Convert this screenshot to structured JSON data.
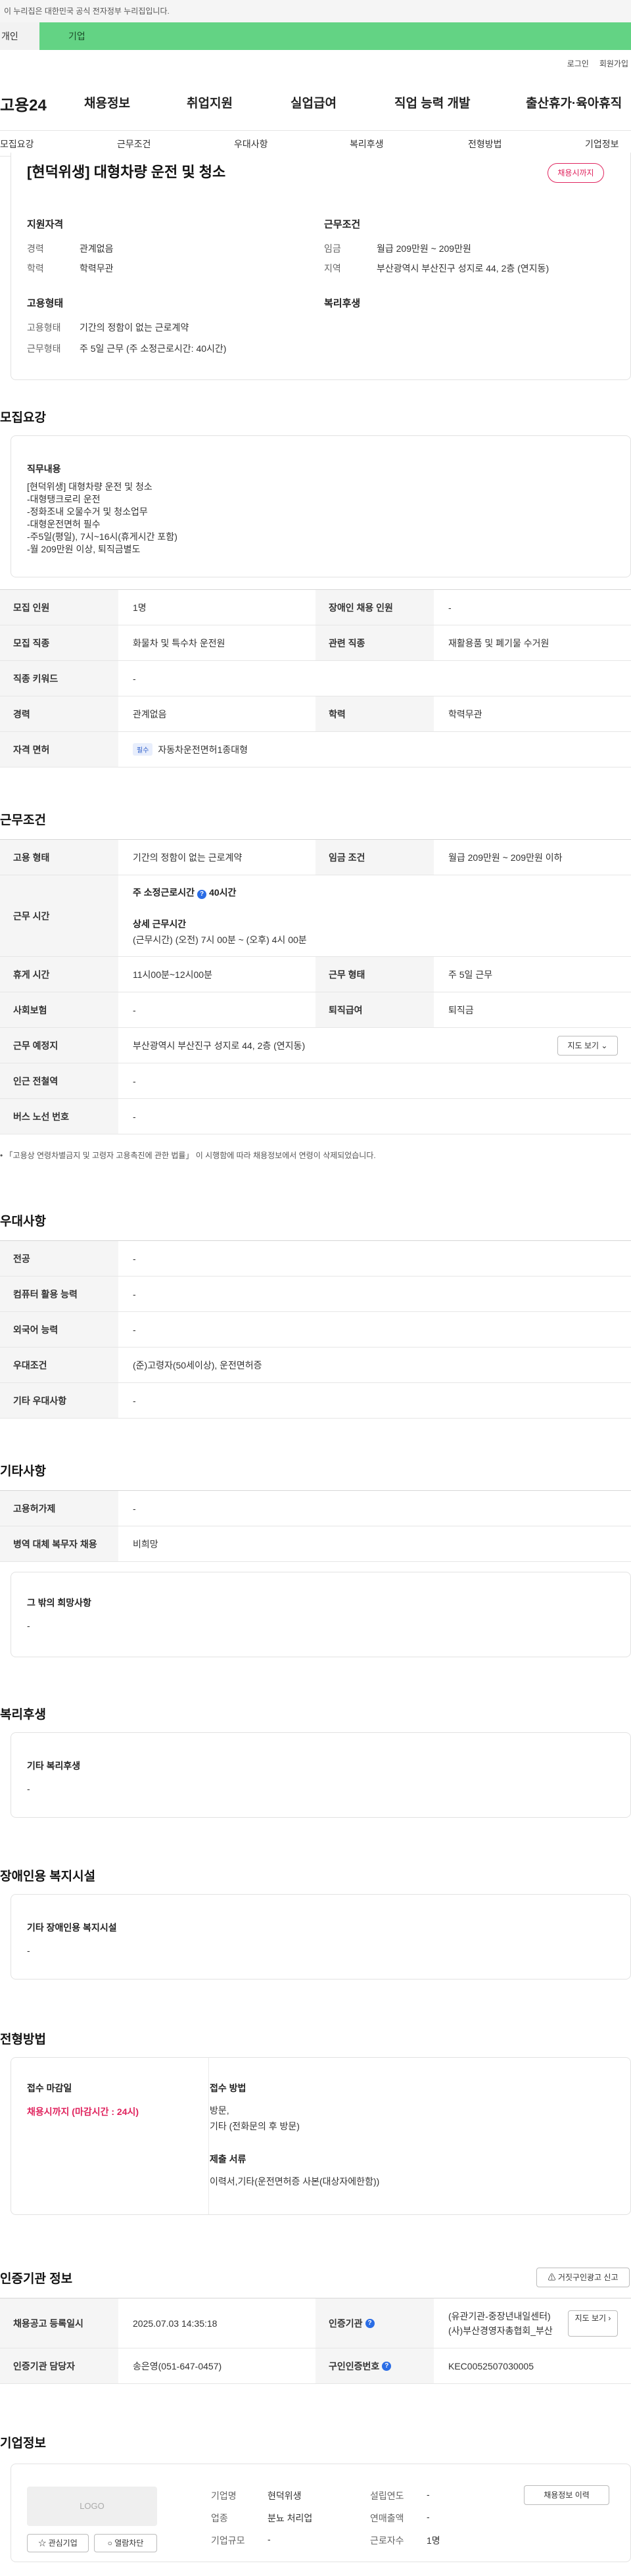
{
  "gov_banner": "이 누리집은 대한민국 공식 전자정부 누리집입니다.",
  "site_tabs": [
    "개인",
    "기업"
  ],
  "util_links": [
    "로그인",
    "회원가입"
  ],
  "logo": "고용24",
  "gnb": [
    "채용정보",
    "취업지원",
    "실업급여",
    "직업 능력 개발",
    "출산휴가·육아휴직"
  ],
  "subnav": [
    "모집요강",
    "근무조건",
    "우대사항",
    "복리후생",
    "전형방법",
    "기업정보"
  ],
  "job": {
    "title": "[현덕위생] 대형차량 운전 및 청소",
    "badge": "채용시까지",
    "qual_head": "지원자격",
    "qual": [
      {
        "k": "경력",
        "v": "관계없음"
      },
      {
        "k": "학력",
        "v": "학력무관"
      }
    ],
    "cond_head": "근무조건",
    "cond": [
      {
        "k": "임금",
        "v": "월급 209만원 ~ 209만원"
      },
      {
        "k": "지역",
        "v": "부산광역시 부산진구 성지로 44, 2층 (연지동)"
      }
    ],
    "emp_head": "고용형태",
    "emp": [
      {
        "k": "고용형태",
        "v": "기간의 정함이 없는 근로계약"
      },
      {
        "k": "근무형태",
        "v": "주 5일 근무 (주 소정근로시간: 40시간)"
      }
    ],
    "welfare_head": "복리후생"
  },
  "recruit": {
    "title": "모집요강",
    "duty_head": "직무내용",
    "duty_body": "[현덕위생] 대형차량 운전 및 청소\n-대형탱크로리 운전\n-정화조내 오물수거 및 청소업무\n-대형운전면허 필수\n-주5일(평일), 7시~16시(휴게시간 포함)\n-월 209만원 이상, 퇴직금별도",
    "rows": [
      {
        "k1": "모집 인원",
        "v1": "1명",
        "k2": "장애인 채용 인원",
        "v2": "-"
      },
      {
        "k1": "모집 직종",
        "v1": "화물차 및 특수차 운전원",
        "k2": "관련 직종",
        "v2": "재활용품 및 폐기물 수거원"
      },
      {
        "k1": "직종 키워드",
        "v1": "-"
      },
      {
        "k1": "경력",
        "v1": "관계없음",
        "k2": "학력",
        "v2": "학력무관"
      },
      {
        "k1": "자격 면허",
        "pill": "필수",
        "v1": "자동차운전면허1종대형"
      }
    ]
  },
  "workcond": {
    "title": "근무조건",
    "r1": {
      "k1": "고용 형태",
      "v1": "기간의 정함이 없는 근로계약",
      "k2": "임금 조건",
      "v2": "월급 209만원 ~ 209만원 이하"
    },
    "r2": {
      "k1": "근무 시간",
      "line1a": "주 소정근로시간",
      "line1b": "40시간",
      "line2": "상세 근무시간",
      "line3": "(근무시간) (오전) 7시 00분 ~ (오후) 4시 00분"
    },
    "r3": {
      "k1": "휴게 시간",
      "v1": "11시00분~12시00분",
      "k2": "근무 형태",
      "v2": "주 5일 근무"
    },
    "r4": {
      "k1": "사회보험",
      "v1": "-",
      "k2": "퇴직급여",
      "v2": "퇴직금"
    },
    "r5": {
      "k1": "근무 예정지",
      "v1": "부산광역시 부산진구 성지로 44, 2층 (연지동)",
      "btn": "지도 보기"
    },
    "r6": {
      "k1": "인근 전철역",
      "v1": "-"
    },
    "r7": {
      "k1": "버스 노선 번호",
      "v1": "-"
    },
    "note": "「고용상 연령차별금지 및 고령자 고용촉진에 관한 법률」 이 시행함에 따라 채용정보에서 연령이 삭제되었습니다."
  },
  "pref": {
    "title": "우대사항",
    "rows": [
      {
        "k": "전공",
        "v": "-"
      },
      {
        "k": "컴퓨터 활용 능력",
        "v": "-"
      },
      {
        "k": "외국어 능력",
        "v": "-"
      },
      {
        "k": "우대조건",
        "v": "(준)고령자(50세이상), 운전면허증"
      },
      {
        "k": "기타 우대사항",
        "v": "-"
      }
    ]
  },
  "etc": {
    "title": "기타사항",
    "rows": [
      {
        "k": "고용허가제",
        "v": "-"
      },
      {
        "k": "병역 대체 복무자 채용",
        "v": "비희망"
      }
    ],
    "card_head": "그 밖의 희망사항",
    "card_body": "-"
  },
  "welfare": {
    "title": "복리후생",
    "card_head": "기타 복리후생",
    "card_body": "-"
  },
  "disabled": {
    "title": "장애인용 복지시설",
    "card_head": "기타 장애인용 복지시설",
    "card_body": "-"
  },
  "screening": {
    "title": "전형방법",
    "deadline_head": "접수 마감일",
    "deadline": "채용시까지 (마감시간 : 24시)",
    "method_head": "접수 방법",
    "method": "방문,\n기타 (전화문의 후 방문)",
    "docs_head": "제출 서류",
    "docs": "이력서,기타(운전면허증 사본(대상자에한함))"
  },
  "cert": {
    "title": "인증기관 정보",
    "report_btn": "거짓구인광고 신고",
    "r1": {
      "k1": "채용공고 등록일시",
      "v1": "2025.07.03 14:35:18",
      "k2": "인증기관",
      "v2": "(유관기관-중장년내일센터) (사)부산경영자총협회_부산",
      "btn": "지도 보기"
    },
    "r2": {
      "k1": "인증기관 담당자",
      "v1": "송은영(051-647-0457)",
      "k2": "구인인증번호",
      "v2": "KEC0052507030005"
    }
  },
  "company": {
    "title": "기업정보",
    "logo_text": "LOGO",
    "fav_btn": "관심기업",
    "block_btn": "열람차단",
    "history_btn": "채용정보 이력",
    "fields": [
      {
        "k": "기업명",
        "v": "현덕위생"
      },
      {
        "k": "업종",
        "v": "분뇨 처리업"
      },
      {
        "k": "기업규모",
        "v": "-"
      },
      {
        "k": "설립연도",
        "v": "-"
      },
      {
        "k": "연매출액",
        "v": "-"
      },
      {
        "k": "근로자수",
        "v": "1명"
      }
    ]
  },
  "colors": {
    "accent_green": "#63d384",
    "badge_red": "#e0245e",
    "info_blue": "#2b6de5"
  }
}
